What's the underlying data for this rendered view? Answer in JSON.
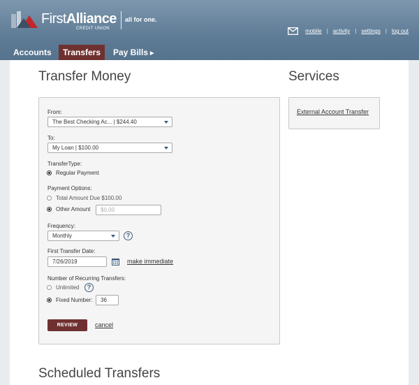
{
  "brand": {
    "name_first": "First",
    "name_second": "Alliance",
    "subtitle": "CREDIT UNION",
    "tagline": "all for one."
  },
  "utility_nav": {
    "mail_icon": "envelope-icon",
    "links": [
      "mobile",
      "activity",
      "settings",
      "log out"
    ]
  },
  "main_nav": {
    "items": [
      "Accounts",
      "Transfers",
      "Pay Bills"
    ],
    "active": "Transfers"
  },
  "transfer_money": {
    "title": "Transfer Money",
    "from_label": "From:",
    "from_value": "The Best Checking Ac... | $244.40",
    "to_label": "To:",
    "to_value": "My Loan | $100.00",
    "transfer_type_label": "TransferType:",
    "transfer_type_option": "Regular Payment",
    "payment_options_label": "Payment Options:",
    "payment_option_total": "Total Amount Due $100.00",
    "payment_option_other": "Other Amount",
    "other_amount_placeholder": "$0.00",
    "frequency_label": "Frequency:",
    "frequency_value": "Monthly",
    "first_date_label": "First Transfer Date:",
    "first_date_value": "7/26/2019",
    "make_immediate": "make immediate",
    "recurring_label": "Number of Recurring Transfers:",
    "recurring_unlimited": "Unlimited",
    "recurring_fixed": "Fixed Number:",
    "recurring_fixed_value": "36",
    "review_button": "REVIEW",
    "cancel_link": "cancel"
  },
  "services": {
    "title": "Services",
    "link": "External Account Transfer"
  },
  "scheduled": {
    "title": "Scheduled Transfers"
  },
  "colors": {
    "header": "#5f7c96",
    "accent": "#6f3130",
    "icon": "#3b5b7d"
  }
}
